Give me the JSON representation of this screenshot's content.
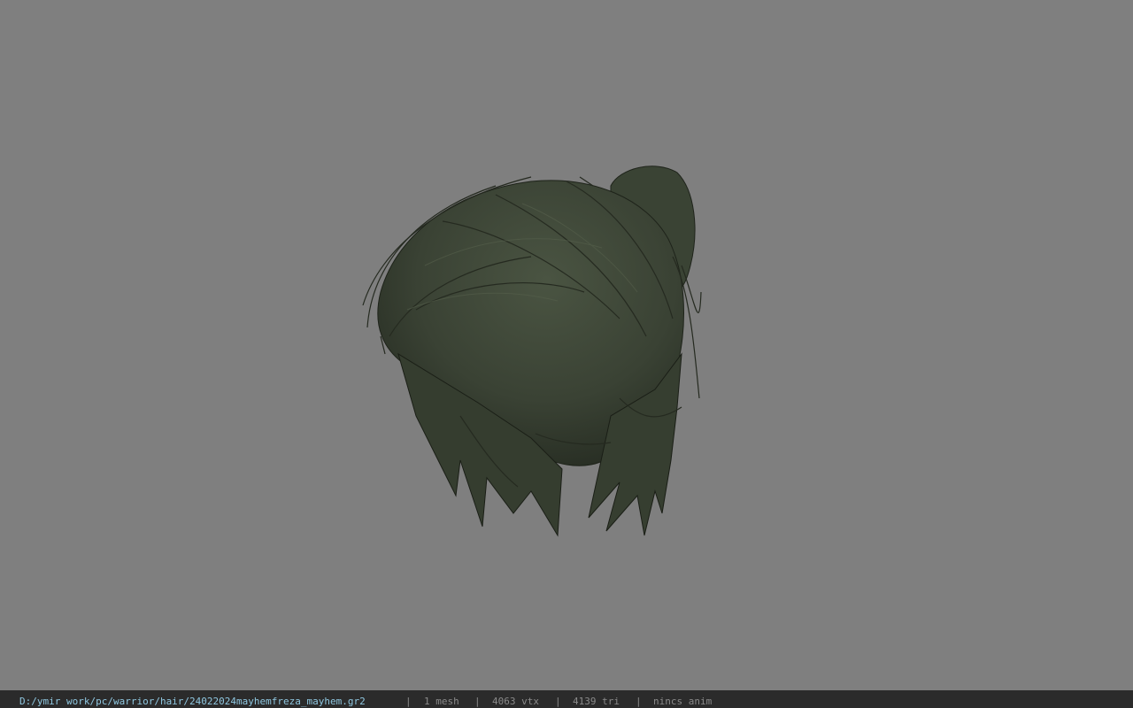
{
  "viewport": {
    "background": "#7f7f7f",
    "model": "hair-mesh",
    "hair_color": "#3c4535"
  },
  "statusbar": {
    "file_path": "D:/ymir work/pc/warrior/hair/24022024mayhemfreza_mayhem.gr2",
    "sep": "|",
    "mesh": "1 mesh",
    "vtx": "4063 vtx",
    "tri": "4139 tri",
    "anim": "nincs anim",
    "path_color": "#8fc7e0",
    "text_color": "#8a8a8a",
    "background": "#2b2b2b"
  }
}
